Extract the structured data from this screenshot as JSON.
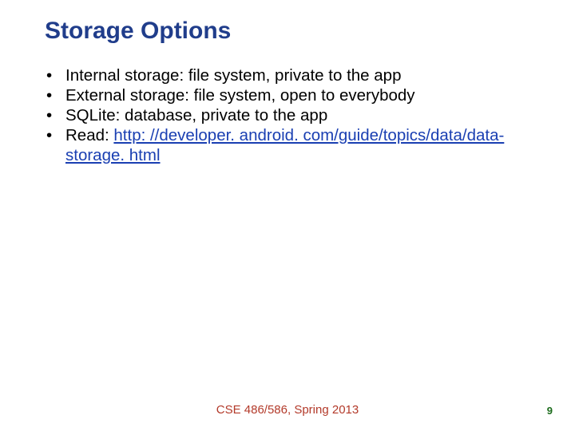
{
  "title": "Storage Options",
  "bullets": [
    {
      "text": "Internal storage: file system, private to the app"
    },
    {
      "text": "External storage: file system, open to everybody"
    },
    {
      "text": "SQLite: database, private to the app"
    },
    {
      "prefix": "Read: ",
      "link_text": "http: //developer. android. com/guide/topics/data/data-storage. html"
    }
  ],
  "footer": "CSE 486/586, Spring 2013",
  "page": "9"
}
